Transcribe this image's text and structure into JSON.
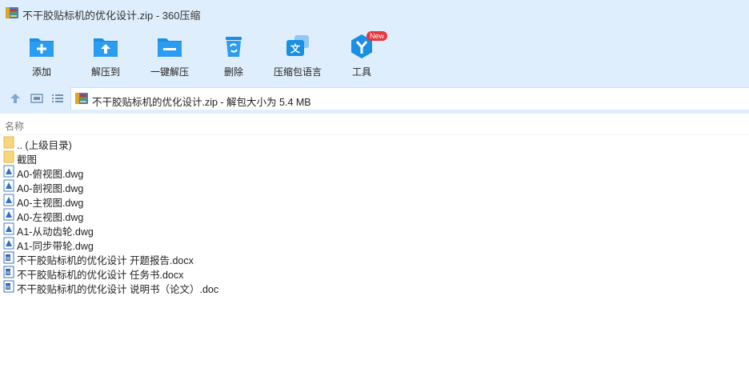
{
  "window": {
    "title": "不干胶贴标机的优化设计.zip - 360压缩"
  },
  "toolbar": {
    "add": "添加",
    "extract_to": "解压到",
    "one_click_extract": "一键解压",
    "delete": "删除",
    "language": "压缩包语言",
    "tools": "工具",
    "tools_badge": "New"
  },
  "path": {
    "text": "不干胶贴标机的优化设计.zip - 解包大小为 5.4 MB"
  },
  "list": {
    "column_name": "名称",
    "items": [
      {
        "name": ".. (上级目录)",
        "type": "folder"
      },
      {
        "name": "截图",
        "type": "folder"
      },
      {
        "name": "A0-俯视图.dwg",
        "type": "dwg"
      },
      {
        "name": "A0-剖视图.dwg",
        "type": "dwg"
      },
      {
        "name": "A0-主视图.dwg",
        "type": "dwg"
      },
      {
        "name": "A0-左视图.dwg",
        "type": "dwg"
      },
      {
        "name": "A1-从动齿轮.dwg",
        "type": "dwg"
      },
      {
        "name": "A1-同步带轮.dwg",
        "type": "dwg"
      },
      {
        "name": "不干胶贴标机的优化设计 开题报告.docx",
        "type": "word"
      },
      {
        "name": "不干胶贴标机的优化设计 任务书.docx",
        "type": "word"
      },
      {
        "name": "不干胶贴标机的优化设计 说明书（论文）.doc",
        "type": "word"
      }
    ]
  },
  "colors": {
    "accent": "#1a8fe3",
    "toolbar_bg": "#dfeefc",
    "badge": "#e8363c"
  }
}
